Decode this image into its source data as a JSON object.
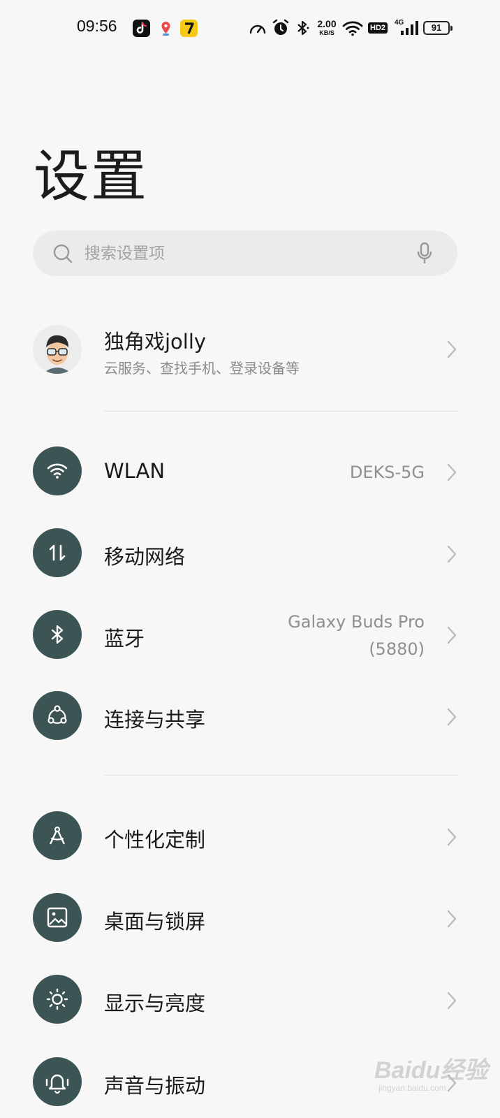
{
  "status_bar": {
    "time": "09:56",
    "speed_value": "2.00",
    "speed_unit": "KB/S",
    "hd_badge": "HD2",
    "network": "4G",
    "battery": "91",
    "icons": [
      "tiktok-icon",
      "maps-icon",
      "app-7-icon",
      "speedometer-icon",
      "alarm-icon",
      "bluetooth-icon",
      "wifi-icon",
      "signal-icon",
      "battery-icon"
    ]
  },
  "page": {
    "title": "设置"
  },
  "search": {
    "placeholder": "搜索设置项",
    "value": ""
  },
  "account": {
    "name": "独角戏jolly",
    "subtitle": "云服务、查找手机、登录设备等"
  },
  "settings": [
    {
      "label": "WLAN",
      "value": "DEKS-5G",
      "icon": "wifi-icon"
    },
    {
      "label": "移动网络",
      "value": "",
      "icon": "mobile-data-icon"
    },
    {
      "label": "蓝牙",
      "value_line1": "Galaxy Buds Pro",
      "value_line2": "(5880)",
      "icon": "bluetooth-icon"
    },
    {
      "label": "连接与共享",
      "value": "",
      "icon": "connection-share-icon"
    },
    {
      "label": "个性化定制",
      "value": "",
      "icon": "personalization-icon"
    },
    {
      "label": "桌面与锁屏",
      "value": "",
      "icon": "wallpaper-icon"
    },
    {
      "label": "显示与亮度",
      "value": "",
      "icon": "brightness-icon"
    },
    {
      "label": "声音与振动",
      "value": "",
      "icon": "sound-vibration-icon"
    }
  ],
  "colors": {
    "background": "#f7f7f7",
    "icon_circle": "#3d5454",
    "search_bg": "#ebebeb",
    "secondary_text": "#8f8f8f"
  },
  "watermark": {
    "main": "Baidu经验",
    "sub": "jingyan.baidu.com"
  }
}
